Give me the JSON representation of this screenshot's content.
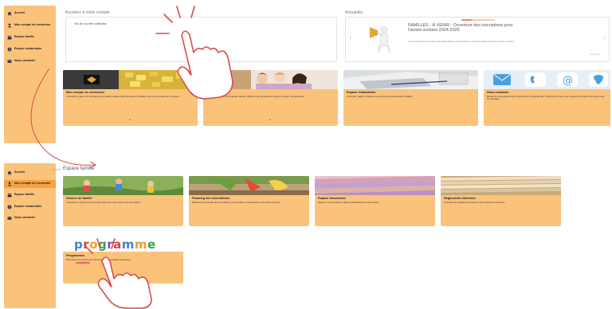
{
  "colors": {
    "sidebar": "#fbc27a",
    "card": "#fbc27a",
    "active": "#f6a243",
    "accent_red": "#d94a4a"
  },
  "sidebar_top": {
    "items": [
      {
        "label": "Accueil",
        "icon": "home-icon"
      },
      {
        "label": "Mon compte de connexion",
        "icon": "user-icon"
      },
      {
        "label": "Espace famille",
        "icon": "family-icon"
      },
      {
        "label": "Espace restauration",
        "icon": "fork-icon"
      },
      {
        "label": "Nous contacter",
        "icon": "mail-icon"
      }
    ]
  },
  "sidebar_bottom": {
    "items": [
      {
        "label": "Accueil",
        "icon": "home-icon"
      },
      {
        "label": "Mon compte de connexion",
        "icon": "user-icon"
      },
      {
        "label": "Espace famille",
        "icon": "family-icon"
      },
      {
        "label": "Espace restauration",
        "icon": "fork-icon"
      },
      {
        "label": "Nous contacter",
        "icon": "mail-icon"
      }
    ]
  },
  "account": {
    "title": "Accédez à votre compte",
    "notice": "Pas de nouvelle notification"
  },
  "news": {
    "title": "Actualités",
    "headline": "FAMILLES - À VENIR : Ouverture des inscriptions pour l'année scolaire 2024-2025",
    "body": "Les inscriptions pour l'année scolaire 2024-2025 seront possibles sur le Portail Famille à partir du lundi 27 mai 2024.",
    "more": "Lire plus",
    "prev": "‹",
    "next": "›",
    "slide_progress": 0.3
  },
  "top_cards": [
    {
      "title": "Mon compte de connexion",
      "desc": "Consultez et gérez vos données personnelles, ajoutez d'autres accès et modifiez votre mot de passe de connexion.",
      "chev": "⌄"
    },
    {
      "title": "Espace famille",
      "desc": "Consultez et gérez votre dossier famille, effectuez vos démarches en ligne et suivez vos paiements.",
      "chev": "⌄"
    },
    {
      "title": "Espace restauration",
      "desc": "Consultez, réglez ou facturez vos services de restauration scolaire.",
      "chev": ""
    },
    {
      "title": "Nous contacter",
      "desc": "Besoin de renseignements ou d'aide pour vos démarches ? Retrouvez ici tous nos moyens de contact et envoyez-nous un message.",
      "chev": ""
    }
  ],
  "breadcrumb": "Accueil",
  "espace_title": "Espace famille",
  "family_cards": [
    {
      "title": "Dossier de famille",
      "desc": "Consultez et mettez à jour les informations de votre foyer et de vos enfants."
    },
    {
      "title": "Planning des réservations",
      "desc": "Réservez les activités de vos enfants pour la cantine, le périscolaire et le centre de loisirs."
    },
    {
      "title": "Espace documents",
      "desc": "Déposez et consultez les pièces justificatives de votre dossier."
    },
    {
      "title": "Règlements intérieurs",
      "desc": "Consultez les règlements intérieurs des structures et services."
    },
    {
      "title": "Programmes",
      "desc": "Retrouvez les programmes des activités et animations proposées."
    }
  ],
  "programme_word": [
    "p",
    "r",
    "o",
    "g",
    "r",
    "a",
    "m",
    "m",
    "e"
  ]
}
